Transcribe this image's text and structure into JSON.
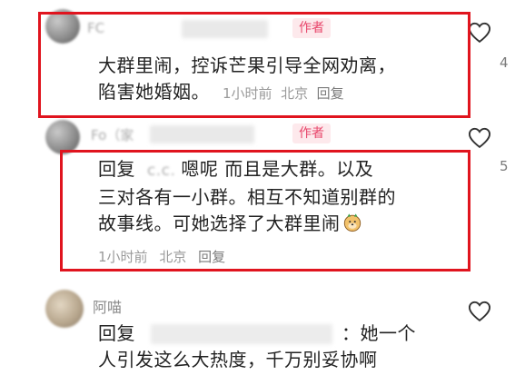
{
  "comments": [
    {
      "name_blurred": "FC",
      "author_badge": "作者",
      "text_lines": [
        "大群里闹，控诉芒果引导全网劝离，",
        "陷害她婚姻。"
      ],
      "time": "1小时前",
      "location": "北京",
      "reply_label": "回复",
      "like_count": "4"
    },
    {
      "name_blurred": "Fo（家",
      "author_badge": "作者",
      "reply_prefix": "回复",
      "mention_blurred": "c.c.",
      "text_lines": [
        "嗯呢 而且是大群。以及",
        "三对各有一小群。相互不知道别群的",
        "故事线。可她选择了大群里闹"
      ],
      "emoji_name": "doge-emoji",
      "time": "1小时前",
      "location": "北京",
      "reply_label": "回复",
      "like_count": "5"
    },
    {
      "name": "阿喵",
      "reply_prefix": "回复",
      "text_lines": [
        "：她一个",
        "人引发这么大热度，千万别妥协啊"
      ]
    }
  ],
  "colors": {
    "highlight_border": "#e0141e",
    "author_badge_text": "#e8456a",
    "author_badge_bg": "#fde9ec"
  }
}
